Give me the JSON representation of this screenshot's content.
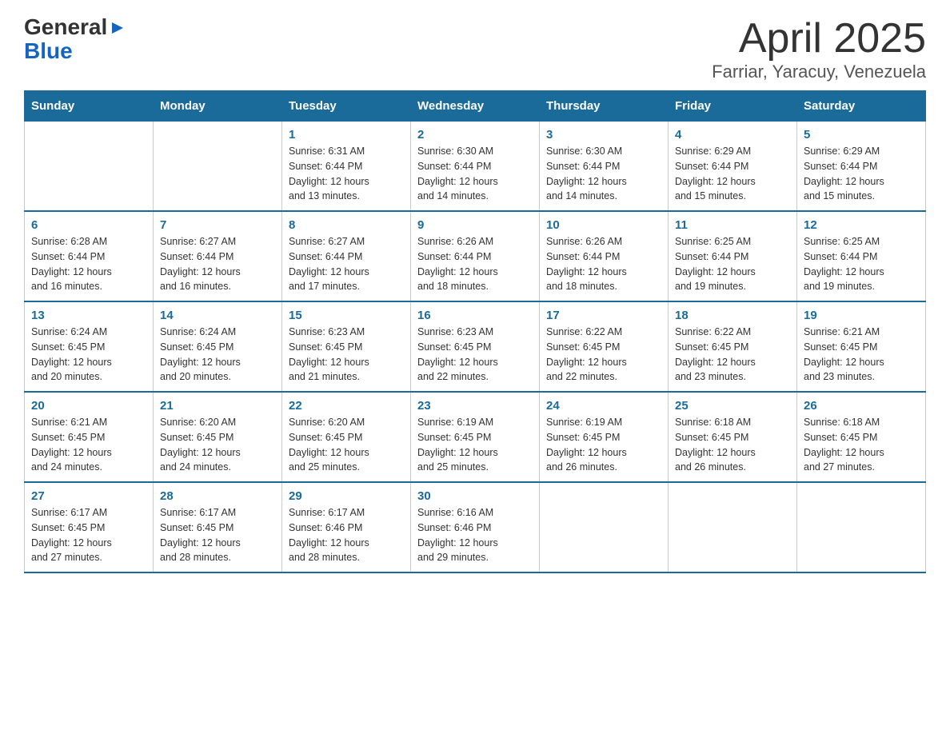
{
  "logo": {
    "text_general": "General",
    "text_blue": "Blue",
    "arrow": "▶"
  },
  "title": "April 2025",
  "subtitle": "Farriar, Yaracuy, Venezuela",
  "headers": [
    "Sunday",
    "Monday",
    "Tuesday",
    "Wednesday",
    "Thursday",
    "Friday",
    "Saturday"
  ],
  "weeks": [
    [
      {
        "num": "",
        "info": ""
      },
      {
        "num": "",
        "info": ""
      },
      {
        "num": "1",
        "info": "Sunrise: 6:31 AM\nSunset: 6:44 PM\nDaylight: 12 hours\nand 13 minutes."
      },
      {
        "num": "2",
        "info": "Sunrise: 6:30 AM\nSunset: 6:44 PM\nDaylight: 12 hours\nand 14 minutes."
      },
      {
        "num": "3",
        "info": "Sunrise: 6:30 AM\nSunset: 6:44 PM\nDaylight: 12 hours\nand 14 minutes."
      },
      {
        "num": "4",
        "info": "Sunrise: 6:29 AM\nSunset: 6:44 PM\nDaylight: 12 hours\nand 15 minutes."
      },
      {
        "num": "5",
        "info": "Sunrise: 6:29 AM\nSunset: 6:44 PM\nDaylight: 12 hours\nand 15 minutes."
      }
    ],
    [
      {
        "num": "6",
        "info": "Sunrise: 6:28 AM\nSunset: 6:44 PM\nDaylight: 12 hours\nand 16 minutes."
      },
      {
        "num": "7",
        "info": "Sunrise: 6:27 AM\nSunset: 6:44 PM\nDaylight: 12 hours\nand 16 minutes."
      },
      {
        "num": "8",
        "info": "Sunrise: 6:27 AM\nSunset: 6:44 PM\nDaylight: 12 hours\nand 17 minutes."
      },
      {
        "num": "9",
        "info": "Sunrise: 6:26 AM\nSunset: 6:44 PM\nDaylight: 12 hours\nand 18 minutes."
      },
      {
        "num": "10",
        "info": "Sunrise: 6:26 AM\nSunset: 6:44 PM\nDaylight: 12 hours\nand 18 minutes."
      },
      {
        "num": "11",
        "info": "Sunrise: 6:25 AM\nSunset: 6:44 PM\nDaylight: 12 hours\nand 19 minutes."
      },
      {
        "num": "12",
        "info": "Sunrise: 6:25 AM\nSunset: 6:44 PM\nDaylight: 12 hours\nand 19 minutes."
      }
    ],
    [
      {
        "num": "13",
        "info": "Sunrise: 6:24 AM\nSunset: 6:45 PM\nDaylight: 12 hours\nand 20 minutes."
      },
      {
        "num": "14",
        "info": "Sunrise: 6:24 AM\nSunset: 6:45 PM\nDaylight: 12 hours\nand 20 minutes."
      },
      {
        "num": "15",
        "info": "Sunrise: 6:23 AM\nSunset: 6:45 PM\nDaylight: 12 hours\nand 21 minutes."
      },
      {
        "num": "16",
        "info": "Sunrise: 6:23 AM\nSunset: 6:45 PM\nDaylight: 12 hours\nand 22 minutes."
      },
      {
        "num": "17",
        "info": "Sunrise: 6:22 AM\nSunset: 6:45 PM\nDaylight: 12 hours\nand 22 minutes."
      },
      {
        "num": "18",
        "info": "Sunrise: 6:22 AM\nSunset: 6:45 PM\nDaylight: 12 hours\nand 23 minutes."
      },
      {
        "num": "19",
        "info": "Sunrise: 6:21 AM\nSunset: 6:45 PM\nDaylight: 12 hours\nand 23 minutes."
      }
    ],
    [
      {
        "num": "20",
        "info": "Sunrise: 6:21 AM\nSunset: 6:45 PM\nDaylight: 12 hours\nand 24 minutes."
      },
      {
        "num": "21",
        "info": "Sunrise: 6:20 AM\nSunset: 6:45 PM\nDaylight: 12 hours\nand 24 minutes."
      },
      {
        "num": "22",
        "info": "Sunrise: 6:20 AM\nSunset: 6:45 PM\nDaylight: 12 hours\nand 25 minutes."
      },
      {
        "num": "23",
        "info": "Sunrise: 6:19 AM\nSunset: 6:45 PM\nDaylight: 12 hours\nand 25 minutes."
      },
      {
        "num": "24",
        "info": "Sunrise: 6:19 AM\nSunset: 6:45 PM\nDaylight: 12 hours\nand 26 minutes."
      },
      {
        "num": "25",
        "info": "Sunrise: 6:18 AM\nSunset: 6:45 PM\nDaylight: 12 hours\nand 26 minutes."
      },
      {
        "num": "26",
        "info": "Sunrise: 6:18 AM\nSunset: 6:45 PM\nDaylight: 12 hours\nand 27 minutes."
      }
    ],
    [
      {
        "num": "27",
        "info": "Sunrise: 6:17 AM\nSunset: 6:45 PM\nDaylight: 12 hours\nand 27 minutes."
      },
      {
        "num": "28",
        "info": "Sunrise: 6:17 AM\nSunset: 6:45 PM\nDaylight: 12 hours\nand 28 minutes."
      },
      {
        "num": "29",
        "info": "Sunrise: 6:17 AM\nSunset: 6:46 PM\nDaylight: 12 hours\nand 28 minutes."
      },
      {
        "num": "30",
        "info": "Sunrise: 6:16 AM\nSunset: 6:46 PM\nDaylight: 12 hours\nand 29 minutes."
      },
      {
        "num": "",
        "info": ""
      },
      {
        "num": "",
        "info": ""
      },
      {
        "num": "",
        "info": ""
      }
    ]
  ]
}
